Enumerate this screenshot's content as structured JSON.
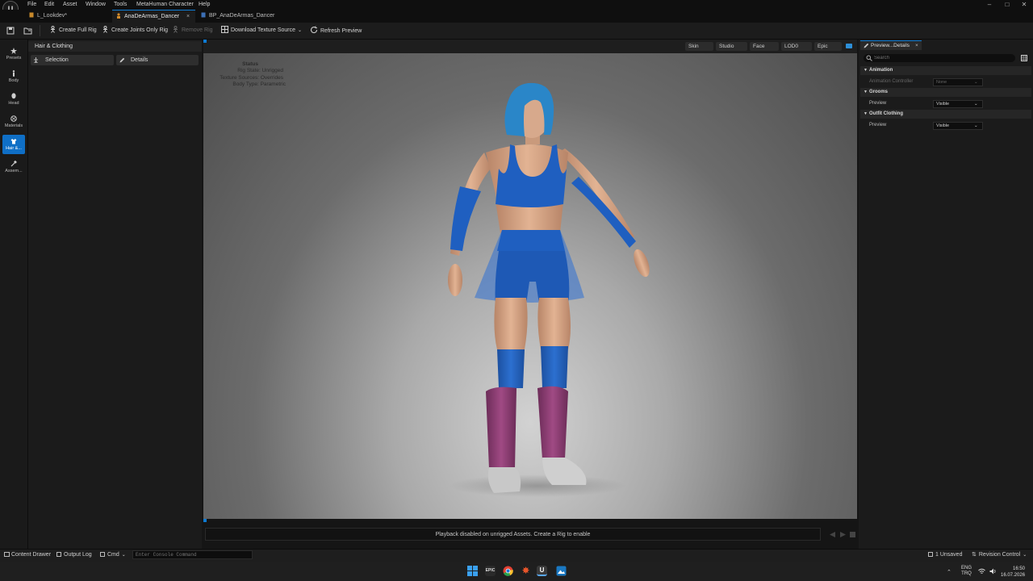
{
  "menubar": {
    "logo": "U",
    "items": [
      "File",
      "Edit",
      "Asset",
      "Window",
      "Tools",
      "MetaHuman Character",
      "Help"
    ]
  },
  "tabs": [
    {
      "label": "L_Lookdev*"
    },
    {
      "label": "AnaDeArmas_Dancer",
      "close": "×"
    },
    {
      "label": "BP_AnaDeArmas_Dancer"
    }
  ],
  "toolbar": {
    "create_full_rig": "Create Full Rig",
    "create_joints_only_rig": "Create Joints Only Rig",
    "remove_rig": "Remove Rig",
    "download_texture_source": "Download Texture Source",
    "refresh_preview": "Refresh Preview"
  },
  "leftnav": [
    {
      "label": "Presets",
      "icon": "star-icon"
    },
    {
      "label": "Body",
      "icon": "body-icon"
    },
    {
      "label": "Head",
      "icon": "head-icon"
    },
    {
      "label": "Materials",
      "icon": "materials-icon"
    },
    {
      "label": "Hair &...",
      "icon": "hair-clothing-icon",
      "active": true
    },
    {
      "label": "Assem...",
      "icon": "assembly-icon"
    }
  ],
  "leftpanel": {
    "title": "Hair & Clothing",
    "selection_label": "Selection",
    "details_label": "Details"
  },
  "viewport": {
    "buttons": [
      "Skin",
      "Studio",
      "Face",
      "LOD0",
      "Epic"
    ],
    "status_title": "Status",
    "status_lines": [
      "Rig State: Unrigged",
      "Texture Sources: Overrides",
      "Body Type: Parametric"
    ],
    "playback_message": "Playback disabled on unrigged Assets. Create a Rig to enable"
  },
  "details": {
    "tab_label": "Preview...Details",
    "search_placeholder": "Search",
    "categories": [
      {
        "name": "Animation",
        "prop": "Animation Controller",
        "value": "None",
        "disabled": true
      },
      {
        "name": "Grooms",
        "prop": "Preview",
        "value": "Visible"
      },
      {
        "name": "Outfit Clothing",
        "prop": "Preview",
        "value": "Visible"
      }
    ]
  },
  "statusbar": {
    "content_drawer": "Content Drawer",
    "output_log": "Output Log",
    "cmd": "Cmd",
    "console_placeholder": "Enter Console Command",
    "unsaved": "1 Unsaved",
    "revision_control": "Revision Control"
  },
  "taskbar": {
    "lang": "ENG",
    "layout": "TRQ",
    "time": "16:50",
    "date": "16.07.2026"
  },
  "colors": {
    "accent": "#0d7bd4",
    "outfit_blue": "#1f5fc0",
    "leg_warmers": "#8e3e72",
    "hair": "#2a86c8"
  }
}
